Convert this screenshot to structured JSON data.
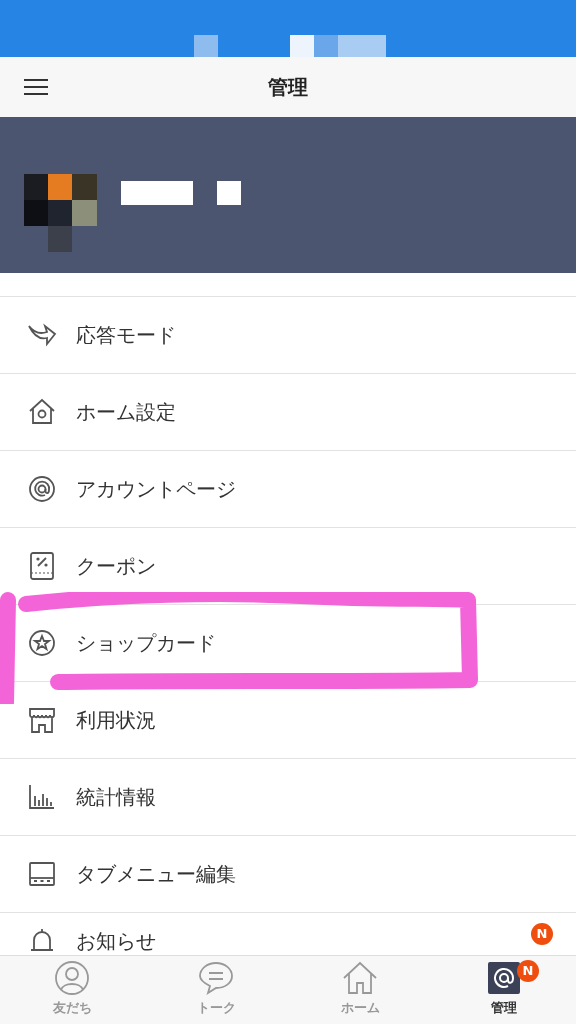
{
  "header": {
    "title": "管理"
  },
  "menu_items": [
    {
      "kind": "reply",
      "label": "応答モード"
    },
    {
      "kind": "home-settings",
      "label": "ホーム設定"
    },
    {
      "kind": "account",
      "label": "アカウントページ"
    },
    {
      "kind": "coupon",
      "label": "クーポン"
    },
    {
      "kind": "shopcard",
      "label": "ショップカード"
    },
    {
      "kind": "usage",
      "label": "利用状況"
    },
    {
      "kind": "stats",
      "label": "統計情報"
    },
    {
      "kind": "tabmenu",
      "label": "タブメニュー編集"
    },
    {
      "kind": "notice",
      "label": "お知らせ",
      "badge": "N"
    }
  ],
  "tab_bar": [
    {
      "kind": "friends",
      "label": "友だち",
      "selected": false
    },
    {
      "kind": "talk",
      "label": "トーク",
      "selected": false
    },
    {
      "kind": "home",
      "label": "ホーム",
      "selected": false
    },
    {
      "kind": "manage",
      "label": "管理",
      "selected": true,
      "badge": "N"
    }
  ]
}
